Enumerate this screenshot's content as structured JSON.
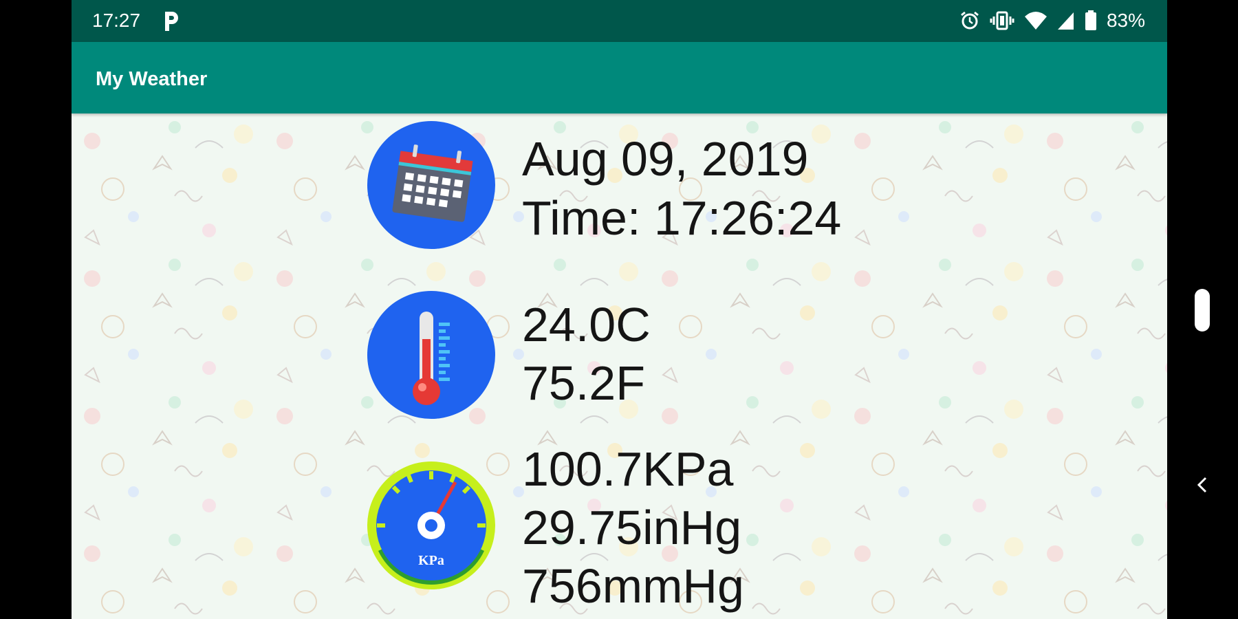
{
  "status_bar": {
    "time": "17:27",
    "notification_icons": [
      "parking-icon"
    ],
    "system_icons": [
      "alarm-icon",
      "vibrate-icon",
      "wifi-icon",
      "signal-icon",
      "battery-icon"
    ],
    "battery_percent": "83%"
  },
  "app_bar": {
    "title": "My Weather",
    "color": "#00897b"
  },
  "readings": {
    "date": "Aug 09, 2019",
    "time": "Time: 17:26:24",
    "temperature_c": "24.0C",
    "temperature_f": "75.2F",
    "pressure_kpa": "100.7KPa",
    "pressure_inhg": "29.75inHg",
    "pressure_mmhg": "756mmHg",
    "gauge_label": "KPa"
  },
  "icons": {
    "date": "calendar-icon",
    "temperature": "thermometer-icon",
    "pressure": "pressure-gauge-icon"
  },
  "colors": {
    "status_bar": "#00574b",
    "icon_circle": "#1f63ef",
    "background": "#f1f8f2"
  }
}
